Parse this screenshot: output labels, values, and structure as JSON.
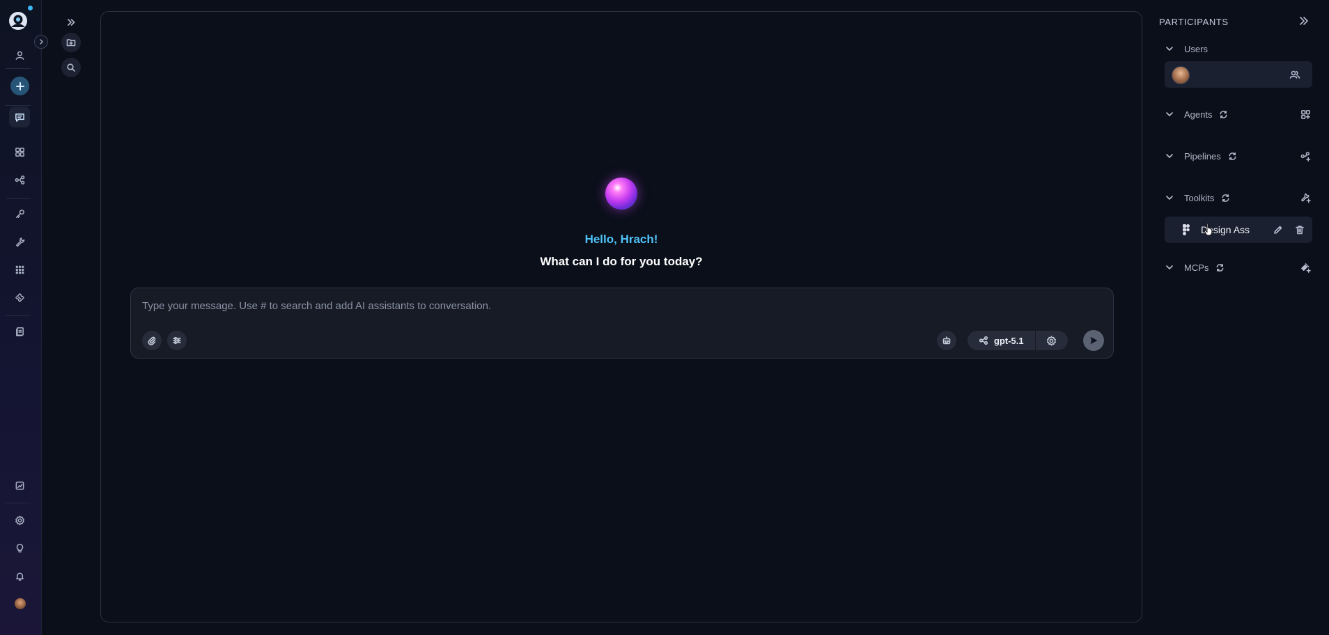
{
  "colors": {
    "accent": "#4fc3f7",
    "background": "#0b0f1a",
    "card": "#1a2030",
    "orb_magenta": "#c43cf0",
    "orb_blue": "#2d9ef0"
  },
  "rail": {
    "logo_icon": "app-logo-icon",
    "items": [
      {
        "name": "profile",
        "icon": "user-icon"
      },
      {
        "name": "new-chat",
        "icon": "plus-icon"
      },
      {
        "name": "chat",
        "icon": "chat-bubble-icon",
        "active": true
      },
      {
        "name": "apps",
        "icon": "grid-icon"
      },
      {
        "name": "pipelines",
        "icon": "pipeline-icon"
      },
      {
        "name": "credentials",
        "icon": "key-icon"
      },
      {
        "name": "toolkits",
        "icon": "wrench-icon"
      },
      {
        "name": "marketplace",
        "icon": "dots-grid-icon"
      },
      {
        "name": "prompts",
        "icon": "ticket-icon"
      },
      {
        "name": "artifacts",
        "icon": "documents-icon"
      },
      {
        "name": "reports",
        "icon": "report-icon"
      },
      {
        "name": "settings",
        "icon": "gear-icon"
      },
      {
        "name": "ideas",
        "icon": "lightbulb-icon"
      },
      {
        "name": "notifications",
        "icon": "bell-icon"
      },
      {
        "name": "account",
        "icon": "avatar"
      }
    ]
  },
  "subcolumn": {
    "items": [
      {
        "name": "expand",
        "icon": "double-chevron-right-icon"
      },
      {
        "name": "new-folder",
        "icon": "folder-plus-icon"
      },
      {
        "name": "search",
        "icon": "search-icon"
      }
    ]
  },
  "main": {
    "greeting": "Hello, Hrach!",
    "subtitle": "What can I do for you today?",
    "composer": {
      "placeholder": "Type your message. Use # to search and add AI assistants to conversation.",
      "value": "",
      "model": "gpt-5.1",
      "buttons": [
        "paperclip-icon",
        "sliders-icon",
        "robot-icon",
        "share-nodes-icon",
        "gear-icon",
        "send-icon"
      ]
    }
  },
  "participants": {
    "title": "PARTICIPANTS",
    "sections": {
      "users": {
        "label": "Users"
      },
      "agents": {
        "label": "Agents"
      },
      "pipelines": {
        "label": "Pipelines"
      },
      "toolkits": {
        "label": "Toolkits"
      },
      "mcps": {
        "label": "MCPs"
      }
    },
    "toolkit_item": {
      "name": "Design Ass"
    }
  }
}
